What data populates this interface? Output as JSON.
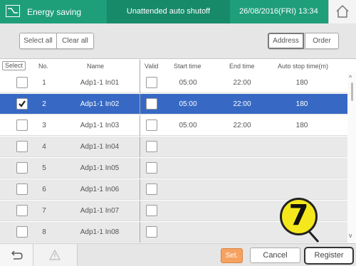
{
  "header": {
    "title": "Energy saving",
    "mode": "Unattended auto shutoff",
    "datetime": "26/08/2016(FRI) 13:34"
  },
  "toolbar": {
    "select_all": "Select all",
    "clear_all": "Clear all",
    "address": "Address",
    "order": "Order"
  },
  "columns": {
    "select": "Select",
    "no": "No.",
    "name": "Name",
    "valid": "Valid",
    "start": "Start time",
    "end": "End time",
    "auto": "Auto stop time(m)"
  },
  "rows": [
    {
      "checked": false,
      "no": "1",
      "name": "Adp1-1 In01",
      "valid": false,
      "start": "05:00",
      "end": "22:00",
      "auto": "180"
    },
    {
      "checked": true,
      "no": "2",
      "name": "Adp1-1 In02",
      "valid": false,
      "start": "05:00",
      "end": "22:00",
      "auto": "180"
    },
    {
      "checked": false,
      "no": "3",
      "name": "Adp1-1 In03",
      "valid": false,
      "start": "05:00",
      "end": "22:00",
      "auto": "180"
    },
    {
      "checked": false,
      "no": "4",
      "name": "Adp1-1 In04",
      "valid": false,
      "start": "",
      "end": "",
      "auto": ""
    },
    {
      "checked": false,
      "no": "5",
      "name": "Adp1-1 In05",
      "valid": false,
      "start": "",
      "end": "",
      "auto": ""
    },
    {
      "checked": false,
      "no": "6",
      "name": "Adp1-1 In06",
      "valid": false,
      "start": "",
      "end": "",
      "auto": ""
    },
    {
      "checked": false,
      "no": "7",
      "name": "Adp1-1 In07",
      "valid": false,
      "start": "",
      "end": "",
      "auto": ""
    },
    {
      "checked": false,
      "no": "8",
      "name": "Adp1-1 In08",
      "valid": false,
      "start": "",
      "end": "",
      "auto": ""
    }
  ],
  "bottom": {
    "set": "Set.",
    "cancel": "Cancel",
    "register": "Register"
  },
  "callout": {
    "step": "7"
  },
  "colors": {
    "header": "#1f9e7a",
    "selected_row": "#3769c4",
    "set_button": "#f5a261",
    "callout": "#f4e81c"
  }
}
